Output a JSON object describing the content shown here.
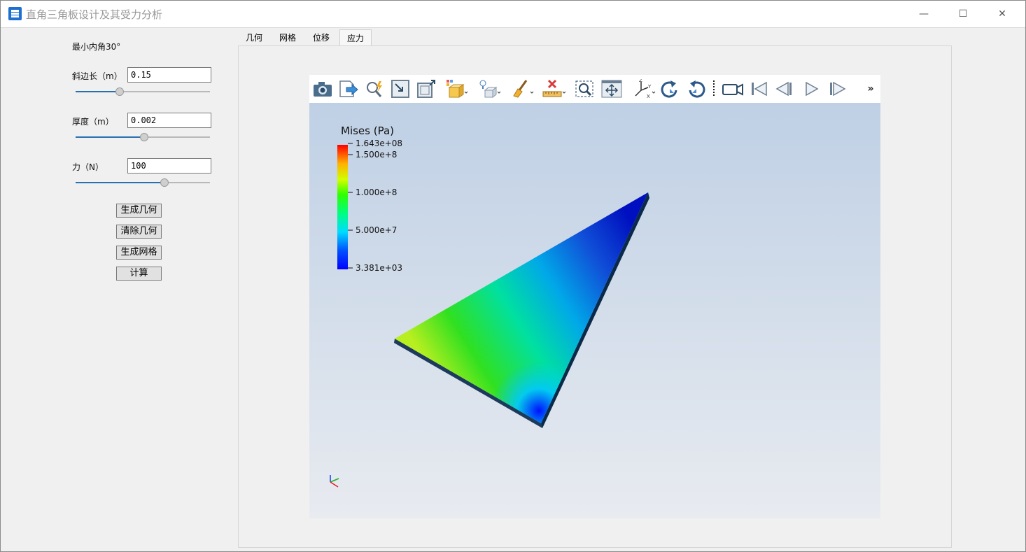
{
  "window": {
    "title": "直角三角板设计及其受力分析"
  },
  "window_controls": {
    "minimize": "—",
    "maximize": "☐",
    "close": "✕"
  },
  "sidebar": {
    "min_angle_label": "最小内角30°",
    "hypotenuse": {
      "label": "斜边长（m）",
      "value": "0.15",
      "slider_fraction": 0.33
    },
    "thickness": {
      "label": "厚度（m）",
      "value": "0.002",
      "slider_fraction": 0.51
    },
    "force": {
      "label": "力（N）",
      "value": "100",
      "slider_fraction": 0.66
    },
    "buttons": {
      "generate_geometry": "生成几何",
      "clear_geometry": "清除几何",
      "generate_mesh": "生成网格",
      "compute": "计算"
    }
  },
  "tabs": [
    {
      "label": "几何",
      "active": false
    },
    {
      "label": "网格",
      "active": false
    },
    {
      "label": "位移",
      "active": false
    },
    {
      "label": "应力",
      "active": true
    }
  ],
  "viewer": {
    "toolbar_icons": [
      "camera-icon",
      "export-icon",
      "zoom-to-data-icon",
      "reset-view-icon",
      "box-select-icon",
      "cube-dropdown-icon",
      "light-cube-icon",
      "broom-clear-icon",
      "ruler-delete-icon",
      "zoom-box-icon",
      "pan-icon",
      "axes-orientation-icon",
      "rotate-cw-icon",
      "rotate-ccw-icon",
      "video-camera-icon",
      "first-frame-icon",
      "previous-frame-icon",
      "play-icon",
      "next-frame-icon",
      "more-icon"
    ],
    "more_glyph": "»",
    "legend": {
      "title": "Mises (Pa)",
      "labels": [
        "1.643e+08",
        "1.500e+8",
        "1.000e+8",
        "5.000e+7",
        "3.381e+03"
      ]
    },
    "colors": {
      "accent": "#2a6fb0",
      "scene_top": "#bfd0e5",
      "scene_bottom": "#e8ebf0"
    }
  }
}
